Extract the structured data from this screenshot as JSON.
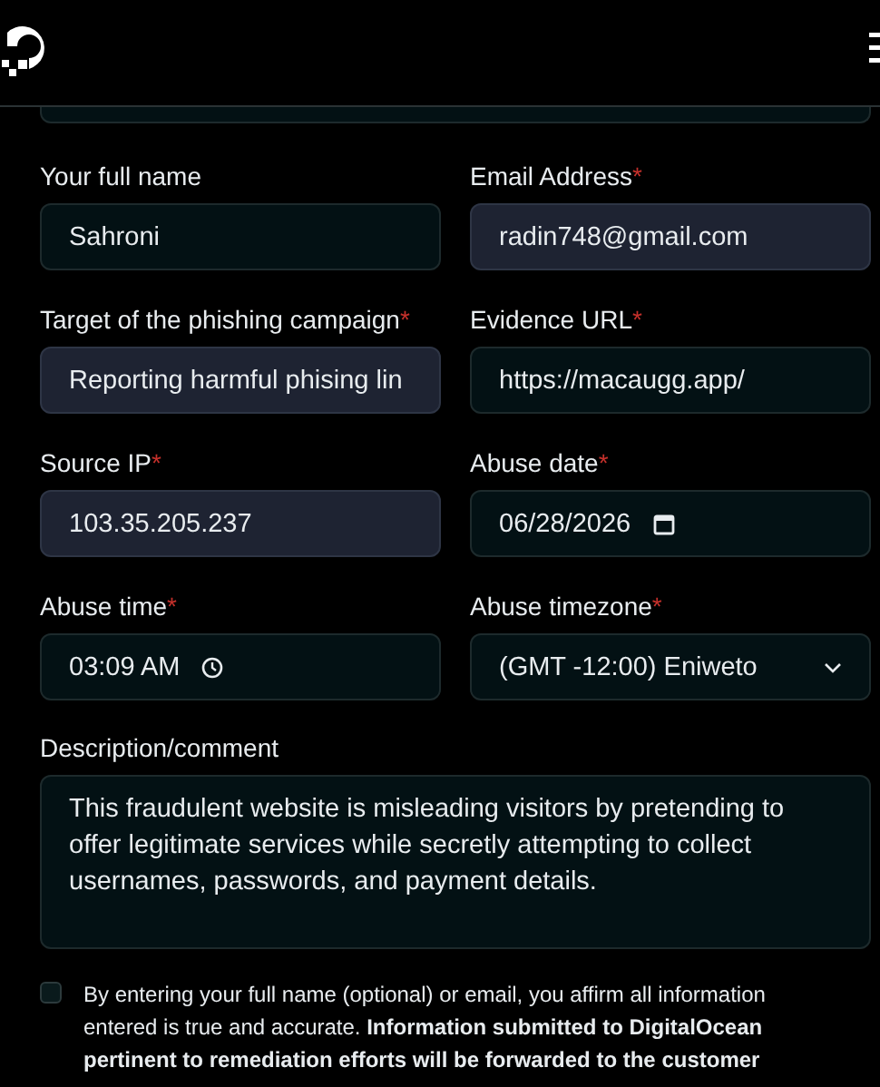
{
  "fields": [
    {
      "kind": "text",
      "label": "Your full name",
      "value": "Sahroni",
      "autofilled": false
    },
    {
      "kind": "text",
      "label": "Email Address",
      "required_mark": "*",
      "value": "radin748@gmail.com",
      "autofilled": true
    },
    {
      "kind": "text",
      "label": "Target of the phishing campaign",
      "required_mark": "*",
      "value": "Reporting harmful phising lin",
      "autofilled": true
    },
    {
      "kind": "text",
      "label": "Evidence URL",
      "required_mark": "*",
      "value": "https://macaugg.app/",
      "autofilled": false
    },
    {
      "kind": "text",
      "label": "Source IP",
      "required_mark": "*",
      "value": "103.35.205.237",
      "autofilled": true
    },
    {
      "kind": "date",
      "label": "Abuse date",
      "required_mark": "*",
      "value": "06/28/2026",
      "autofilled": false
    },
    {
      "kind": "time",
      "label": "Abuse time",
      "required_mark": "*",
      "value": "03:09  AM",
      "autofilled": false
    },
    {
      "kind": "select",
      "label": "Abuse timezone",
      "required_mark": "*",
      "value": "(GMT -12:00) Eniweto",
      "autofilled": false
    }
  ],
  "description": {
    "label": "Description/comment",
    "value": "This fraudulent website is misleading visitors by pretending to offer legitimate services while secretly attempting to collect usernames, passwords, and payment details."
  },
  "consent": {
    "checked": false,
    "text": "By entering your full name (optional) or email, you affirm all information entered is true and accurate. **Information submitted to DigitalOcean pertinent to remediation efforts will be forwarded to the customer**"
  }
}
